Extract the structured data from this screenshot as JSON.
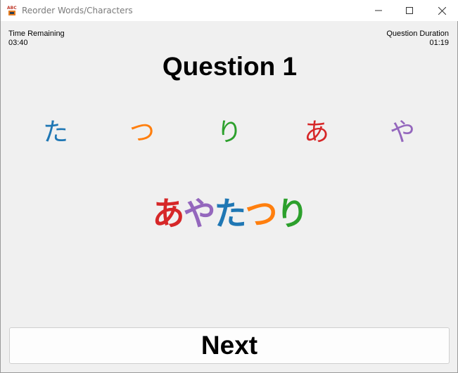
{
  "window": {
    "title": "Reorder Words/Characters",
    "app_icon": "abc-app-icon"
  },
  "timer": {
    "remaining_label": "Time Remaining",
    "remaining_value": "03:40",
    "duration_label": "Question Duration",
    "duration_value": "01:19"
  },
  "question": {
    "title": "Question 1"
  },
  "choices": [
    {
      "char": "た",
      "color": "#1f77b4"
    },
    {
      "char": "つ",
      "color": "#ff7f0e"
    },
    {
      "char": "り",
      "color": "#2ca02c"
    },
    {
      "char": "あ",
      "color": "#d62728"
    },
    {
      "char": "や",
      "color": "#9467bd"
    }
  ],
  "answer": [
    {
      "char": "あ",
      "color": "#d62728"
    },
    {
      "char": "や",
      "color": "#9467bd"
    },
    {
      "char": "た",
      "color": "#1f77b4"
    },
    {
      "char": "つ",
      "color": "#ff7f0e"
    },
    {
      "char": "り",
      "color": "#2ca02c"
    }
  ],
  "next_button": {
    "label": "Next"
  }
}
